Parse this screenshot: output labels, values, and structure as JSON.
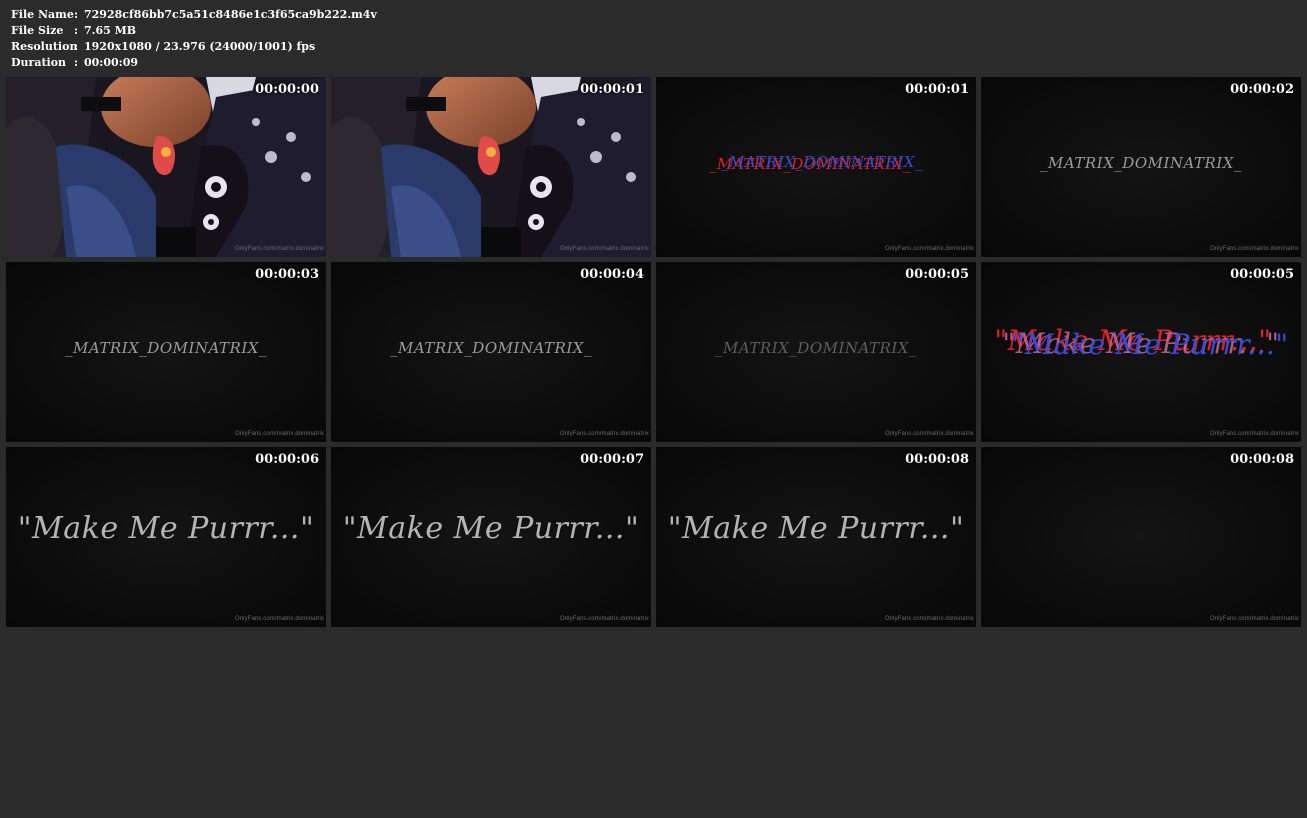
{
  "file_info": {
    "file_name_label": "File Name",
    "file_name": "72928cf86bb7c5a51c8486e1c3f65ca9b222.m4v",
    "file_size_label": "File Size",
    "file_size": "7.65 MB",
    "resolution_label": "Resolution",
    "resolution": "1920x1080 / 23.976 (24000/1001) fps",
    "duration_label": "Duration",
    "duration": "00:00:09",
    "separator": ":"
  },
  "watermark": "OnlyFans.com/matrix.dominatrix",
  "text_matrix": "_MATRIX_DOMINATRIX_",
  "text_purr": "\"Make Me Purrr...\"",
  "thumbnails": [
    {
      "time": "00:00:00"
    },
    {
      "time": "00:00:01"
    },
    {
      "time": "00:00:01"
    },
    {
      "time": "00:00:02"
    },
    {
      "time": "00:00:03"
    },
    {
      "time": "00:00:04"
    },
    {
      "time": "00:00:05"
    },
    {
      "time": "00:00:05"
    },
    {
      "time": "00:00:06"
    },
    {
      "time": "00:00:07"
    },
    {
      "time": "00:00:08"
    },
    {
      "time": "00:00:08"
    }
  ]
}
